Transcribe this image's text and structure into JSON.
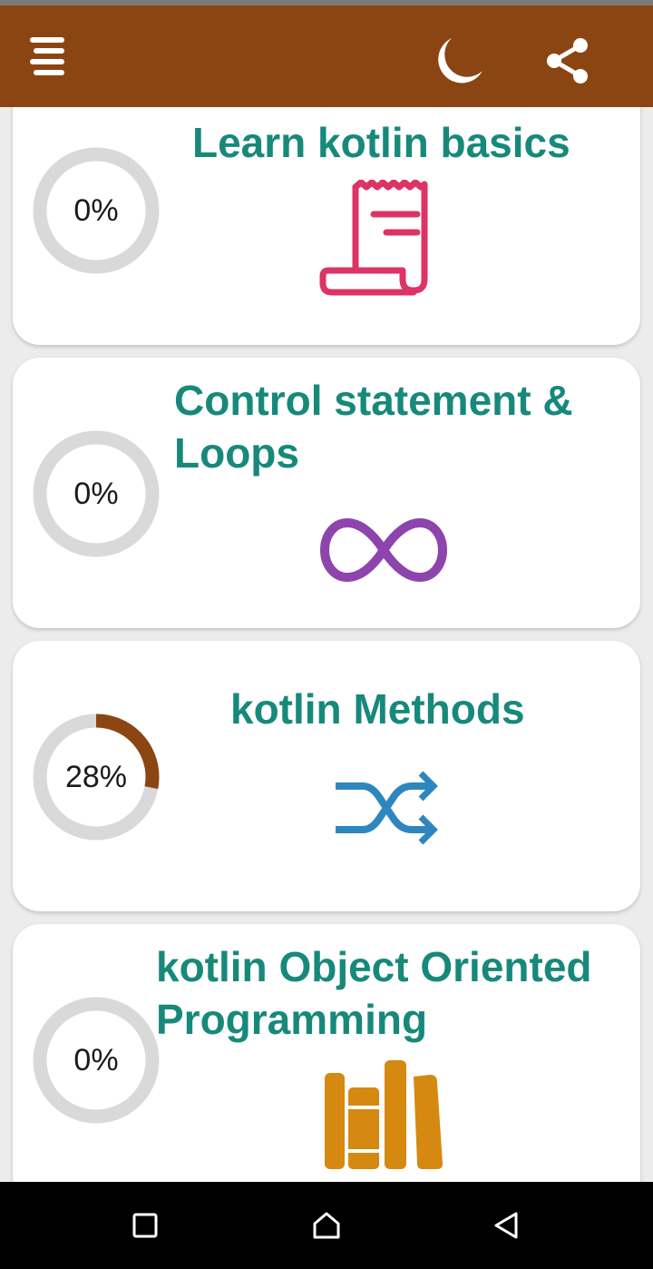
{
  "app_bar": {
    "menu_icon": "hamburger-menu-icon",
    "theme_icon": "moon-icon",
    "share_icon": "share-icon",
    "background_color": "#8b4513"
  },
  "topics": [
    {
      "title": "Learn kotlin basics",
      "progress_label": "0%",
      "progress": 0,
      "icon": "document-scroll-icon",
      "icon_color": "#dd3366"
    },
    {
      "title": "Control statement & Loops",
      "progress_label": "0%",
      "progress": 0,
      "icon": "infinity-loop-icon",
      "icon_color": "#8e44ad"
    },
    {
      "title": "kotlin Methods",
      "progress_label": "28%",
      "progress": 0.28,
      "icon": "shuffle-arrows-icon",
      "icon_color": "#2e86c1"
    },
    {
      "title": "kotlin Object Oriented Programming",
      "progress_label": "0%",
      "progress": 0,
      "icon": "books-icon",
      "icon_color": "#d68910"
    }
  ],
  "colors": {
    "title": "#17897b",
    "progress_track": "#d9d9d9",
    "progress_fill": "#8b4513"
  },
  "nav_bar": {
    "recents_icon": "recents-square-icon",
    "home_icon": "home-icon",
    "back_icon": "back-triangle-icon"
  }
}
